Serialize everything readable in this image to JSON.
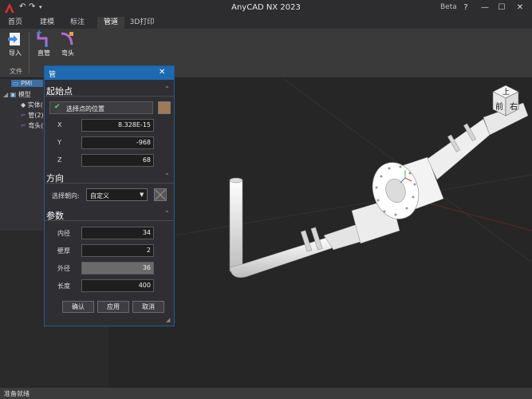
{
  "app": {
    "title": "AnyCAD NX 2023",
    "badge": "Beta",
    "accent": "#1e6ab0"
  },
  "tabs": [
    "首页",
    "建模",
    "标注",
    "管道",
    "3D打印"
  ],
  "active_tab": "管道",
  "ribbon": {
    "buttons": [
      {
        "label": "导入",
        "icon": "import-icon"
      },
      {
        "label": "直管",
        "icon": "straight-pipe-icon"
      },
      {
        "label": "弯头",
        "icon": "elbow-icon"
      }
    ],
    "group_label": "文件"
  },
  "tree": {
    "items": [
      "PMI",
      "模型",
      "实体(",
      "管(2)",
      "弯头("
    ]
  },
  "dialog": {
    "title": "管",
    "start": {
      "header": "起始点",
      "pick_label": "选择点的位置",
      "x_label": "X",
      "x_value": "8.328E-15",
      "y_label": "Y",
      "y_value": "-968",
      "z_label": "Z",
      "z_value": "68"
    },
    "direction": {
      "header": "方向",
      "label": "选择朝向:",
      "value": "自定义"
    },
    "params": {
      "header": "参数",
      "inner_label": "内径",
      "inner_value": "34",
      "wall_label": "壁厚",
      "wall_value": "2",
      "outer_label": "外径",
      "outer_value": "36",
      "length_label": "长度",
      "length_value": "400"
    },
    "buttons": {
      "ok": "确认",
      "apply": "应用",
      "cancel": "取消"
    }
  },
  "viewcube": {
    "top": "上",
    "front": "前",
    "right": "右"
  },
  "status": "准备就绪"
}
